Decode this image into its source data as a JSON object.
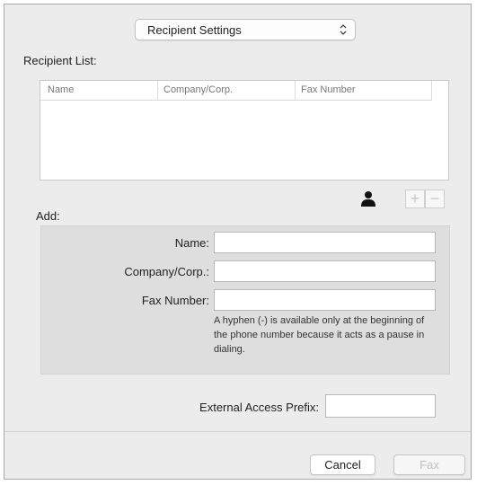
{
  "settings_popup": {
    "label": "Recipient Settings",
    "arrow_glyph": "⌃⌄"
  },
  "recipient_list": {
    "label": "Recipient List:",
    "columns": [
      "Name",
      "Company/Corp.",
      "Fax Number"
    ]
  },
  "list_controls": {
    "plus": "+",
    "minus": "−"
  },
  "add_section": {
    "label": "Add:",
    "name_label": "Name:",
    "name_value": "",
    "company_label": "Company/Corp.:",
    "company_value": "",
    "fax_label": "Fax Number:",
    "fax_value": "",
    "hint": "A hyphen (-) is available only at the beginning of the phone number because it acts as a pause in dialing."
  },
  "external_access": {
    "label": "External Access Prefix:",
    "value": ""
  },
  "buttons": {
    "cancel": "Cancel",
    "fax": "Fax"
  }
}
